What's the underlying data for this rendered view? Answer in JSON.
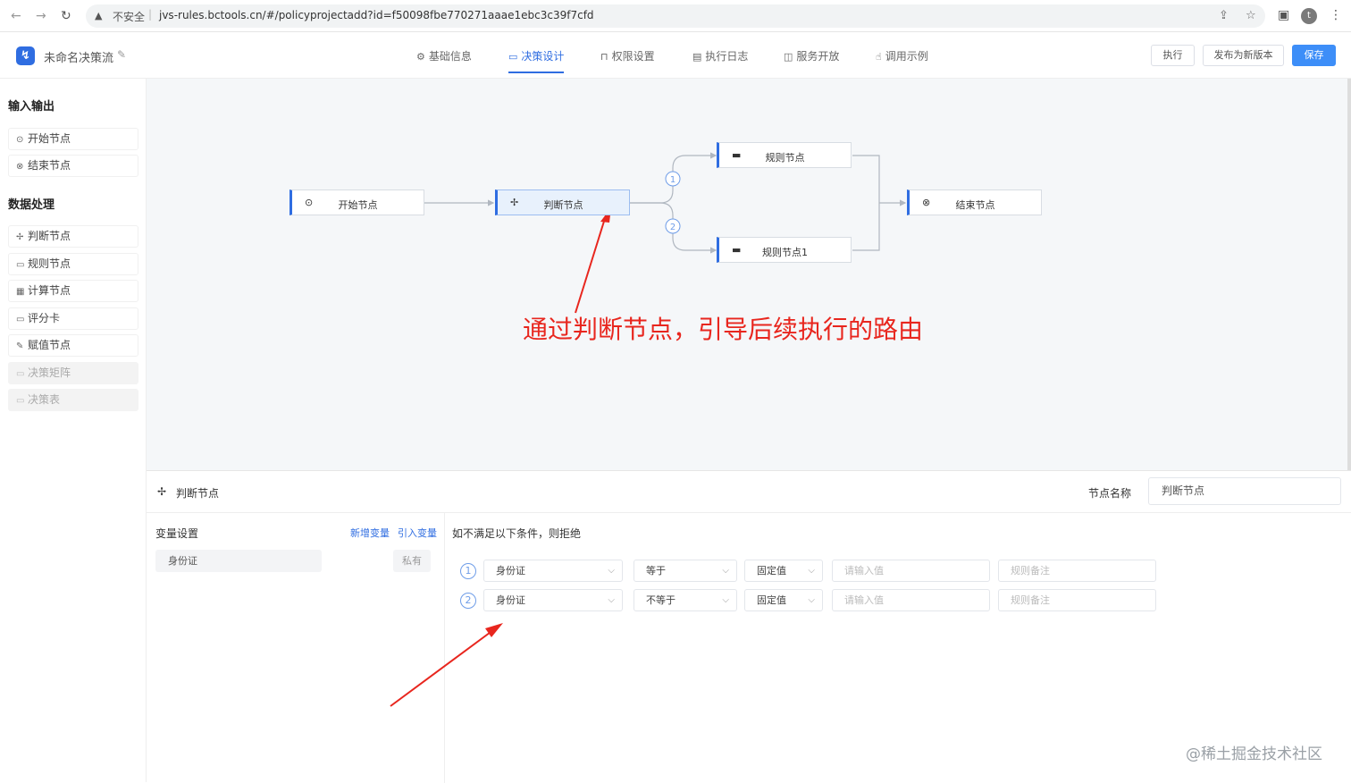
{
  "browser": {
    "back": "←",
    "forward": "→",
    "reload": "↻",
    "security_icon": "▲",
    "security_label": "不安全",
    "separator": "|",
    "url": "jvs-rules.bctools.cn/#/policyprojectadd?id=f50098fbe770271aaae1ebc3c39f7cfd",
    "profile_initial": "t"
  },
  "app": {
    "title": "未命名决策流",
    "tabs": [
      {
        "label": "基础信息",
        "icon": "gear-icon"
      },
      {
        "label": "决策设计",
        "icon": "monitor-icon"
      },
      {
        "label": "权限设置",
        "icon": "lock-icon"
      },
      {
        "label": "执行日志",
        "icon": "document-icon"
      },
      {
        "label": "服务开放",
        "icon": "book-icon"
      },
      {
        "label": "调用示例",
        "icon": "thumb-icon"
      }
    ],
    "active_tab": "决策设计",
    "buttons": {
      "execute": "执行",
      "publish": "发布为新版本",
      "save": "保存"
    }
  },
  "sidebar": {
    "section1": "输入输出",
    "io_items": [
      {
        "label": "开始节点",
        "icon": "play-circle-icon"
      },
      {
        "label": "结束节点",
        "icon": "close-circle-icon"
      }
    ],
    "section2": "数据处理",
    "proc_items": [
      {
        "label": "判断节点",
        "icon": "move-icon",
        "disabled": false
      },
      {
        "label": "规则节点",
        "icon": "card-icon",
        "disabled": false
      },
      {
        "label": "计算节点",
        "icon": "calculator-icon",
        "disabled": false
      },
      {
        "label": "评分卡",
        "icon": "card-icon",
        "disabled": false
      },
      {
        "label": "赋值节点",
        "icon": "edit-icon",
        "disabled": false
      },
      {
        "label": "决策矩阵",
        "icon": "card-icon",
        "disabled": true
      },
      {
        "label": "决策表",
        "icon": "card-icon",
        "disabled": true
      }
    ]
  },
  "flow": {
    "nodes": {
      "start": "开始节点",
      "judge": "判断节点",
      "rule": "规则节点",
      "rule1": "规则节点1",
      "end": "结束节点"
    },
    "branches": [
      "1",
      "2"
    ]
  },
  "annotation": "通过判断节点，引导后续执行的路由",
  "panel": {
    "node_type": "判断节点",
    "node_name_label": "节点名称",
    "node_name_value": "判断节点",
    "vars_title": "变量设置",
    "add_var": "新增变量",
    "import_var": "引入变量",
    "var_name": "身份证",
    "var_scope": "私有",
    "rules_title": "如不满足以下条件，则拒绝",
    "conditions": [
      {
        "num": "1",
        "field": "身份证",
        "op": "等于",
        "type": "固定值",
        "value_placeholder": "请输入值",
        "note_placeholder": "规则备注"
      },
      {
        "num": "2",
        "field": "身份证",
        "op": "不等于",
        "type": "固定值",
        "value_placeholder": "请输入值",
        "note_placeholder": "规则备注"
      }
    ]
  },
  "watermark": "@稀土掘金技术社区",
  "colors": {
    "accent": "#2f6de1",
    "primary_button": "#3d8ef8",
    "annotation": "#e8261e",
    "canvas_bg": "#f5f7f9"
  }
}
